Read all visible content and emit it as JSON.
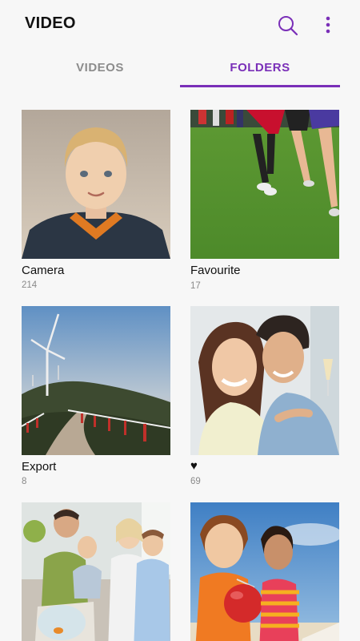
{
  "header": {
    "title": "VIDEO",
    "search_icon": "search-icon",
    "more_icon": "more-vertical-icon"
  },
  "accent_color": "#7a2fb8",
  "tabs": [
    {
      "label": "VIDEOS",
      "selected": false
    },
    {
      "label": "FOLDERS",
      "selected": true
    }
  ],
  "folders": [
    {
      "label": "Camera",
      "count": "214",
      "thumbnail": "boy-portrait"
    },
    {
      "label": "Favourite",
      "count": "17",
      "thumbnail": "runners-on-grass"
    },
    {
      "label": "Export",
      "count": "8",
      "thumbnail": "wind-turbine-road"
    },
    {
      "label": "♥",
      "count": "69",
      "thumbnail": "smiling-couple"
    },
    {
      "label": "",
      "count": "",
      "thumbnail": "family-on-sofa"
    },
    {
      "label": "",
      "count": "",
      "thumbnail": "kids-with-ball"
    }
  ]
}
